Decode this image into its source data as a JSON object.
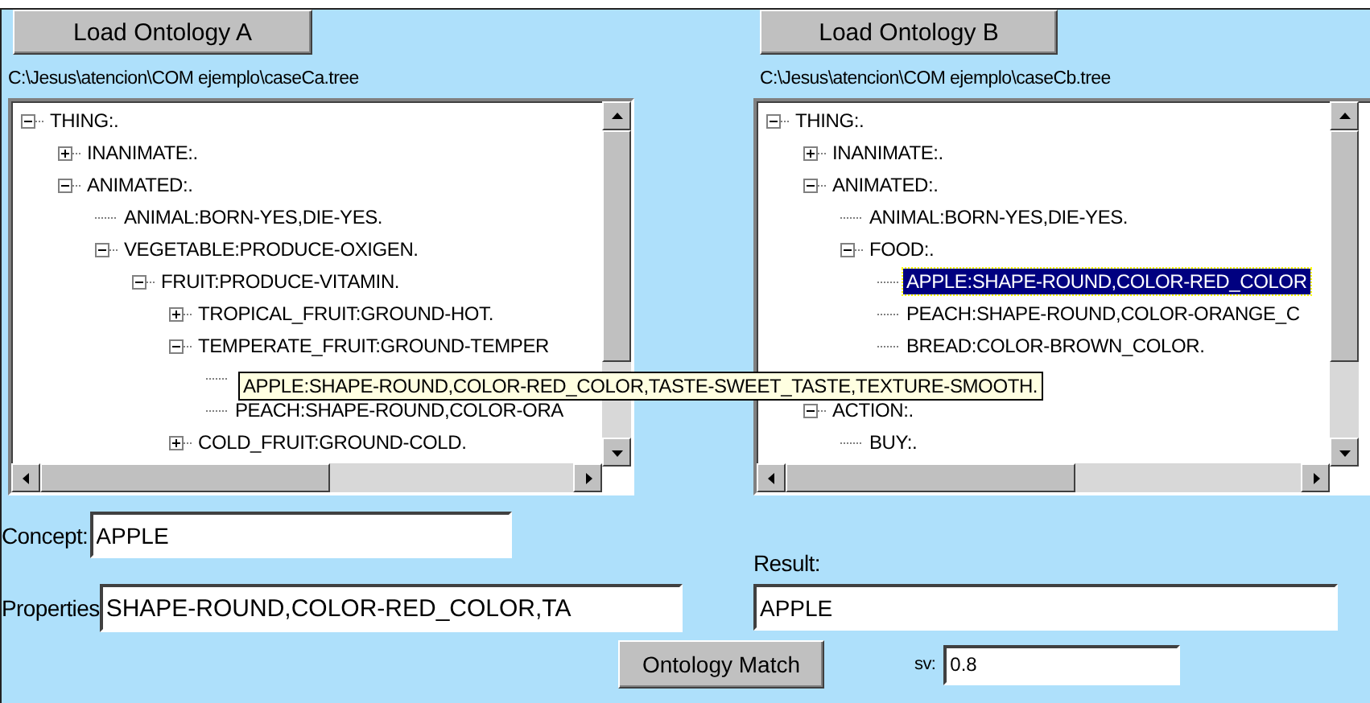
{
  "panels": [
    {
      "button": "Load Ontology A",
      "path": "C:\\Jesus\\atencion\\COM ejemplo\\caseCa.tree",
      "tree": [
        {
          "label": "THING:.",
          "expanded": true,
          "selected": false,
          "children": [
            {
              "label": "INANIMATE:.",
              "expanded": false,
              "selected": false
            },
            {
              "label": "ANIMATED:.",
              "expanded": true,
              "selected": false,
              "children": [
                {
                  "label": "ANIMAL:BORN-YES,DIE-YES.",
                  "selected": false
                },
                {
                  "label": "VEGETABLE:PRODUCE-OXIGEN.",
                  "expanded": true,
                  "selected": false,
                  "children": [
                    {
                      "label": "FRUIT:PRODUCE-VITAMIN.",
                      "expanded": true,
                      "selected": false,
                      "children": [
                        {
                          "label": "TROPICAL_FRUIT:GROUND-HOT.",
                          "expanded": false,
                          "selected": false
                        },
                        {
                          "label": "TEMPERATE_FRUIT:GROUND-TEMPER",
                          "expanded": true,
                          "selected": false,
                          "children": [
                            {
                              "tooltip": "APPLE:SHAPE-ROUND,COLOR-RED_COLOR,TASTE-SWEET_TASTE,TEXTURE-SMOOTH."
                            },
                            {
                              "label": "PEACH:SHAPE-ROUND,COLOR-ORA",
                              "selected": false
                            }
                          ]
                        },
                        {
                          "label": "COLD_FRUIT:GROUND-COLD.",
                          "expanded": false,
                          "selected": false
                        }
                      ]
                    }
                  ]
                }
              ]
            }
          ]
        }
      ]
    },
    {
      "button": "Load Ontology B",
      "path": "C:\\Jesus\\atencion\\COM ejemplo\\caseCb.tree",
      "tree": [
        {
          "label": "THING:.",
          "expanded": true,
          "selected": false,
          "children": [
            {
              "label": "INANIMATE:.",
              "expanded": false,
              "selected": false
            },
            {
              "label": "ANIMATED:.",
              "expanded": true,
              "selected": false,
              "children": [
                {
                  "label": "ANIMAL:BORN-YES,DIE-YES.",
                  "selected": false
                },
                {
                  "label": "FOOD:.",
                  "expanded": true,
                  "selected": false,
                  "children": [
                    {
                      "label": "APPLE:SHAPE-ROUND,COLOR-RED_COLOR",
                      "selected": true
                    },
                    {
                      "label": "PEACH:SHAPE-ROUND,COLOR-ORANGE_C",
                      "selected": false
                    },
                    {
                      "label": "BREAD:COLOR-BROWN_COLOR.",
                      "selected": false
                    }
                  ]
                }
              ]
            },
            {
              "label": "ACTION:.",
              "expanded": true,
              "selected": false,
              "children": [
                {
                  "label": "BUY:.",
                  "selected": false
                }
              ]
            }
          ]
        }
      ]
    }
  ],
  "concept": {
    "label": "Concept:",
    "value": "APPLE"
  },
  "properties": {
    "label": "Properties",
    "value": "SHAPE-ROUND,COLOR-RED_COLOR,TA"
  },
  "result": {
    "label": "Result:",
    "value": "APPLE"
  },
  "match_button": "Ontology Match",
  "sv": {
    "label": "sv:",
    "value": "0.8"
  }
}
